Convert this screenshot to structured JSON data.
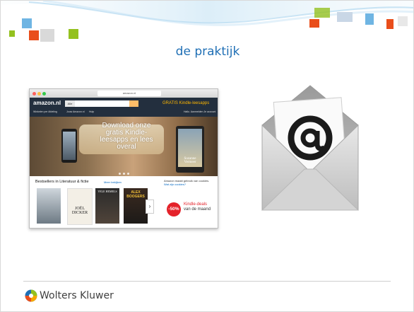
{
  "slide": {
    "title": "de praktijk",
    "accent": "#1f6fb5"
  },
  "footer": {
    "company": "Wolters Kluwer"
  },
  "amazon_screenshot": {
    "url": "amazon.nl",
    "logo": "amazon.nl",
    "search_scope": "Alle",
    "promo": "GRATIS Kindle-leesapps",
    "nav_left": "Winkelen per Afdeling",
    "nav_links": [
      "Jouw Amazon.nl",
      "Hulp"
    ],
    "nav_account": "Hallo. Aanmelden Je account",
    "banner_heading": "Download onze gratis Kindle-leesapps en lees overal",
    "banner_book": "Suzanne Vermeer",
    "bestsellers_title": "Bestsellers in Literatuur & fictie",
    "bestsellers_link": "Meer bekijken",
    "books": [
      {
        "title": ""
      },
      {
        "title": "JOËL DICKER"
      },
      {
        "title": "VELE HEMELS"
      },
      {
        "title": "ALEX BOOGERS"
      }
    ],
    "cookie_text": "Amazon maakt gebruik van cookies.",
    "cookie_link": "Wat zijn cookies?",
    "deal_badge": "-50%",
    "deal_line1": "Kindle-deals",
    "deal_line2": "van de maand"
  },
  "icons": {
    "email": "at-sign-envelope-icon",
    "logo": "wolters-kluwer-globe-icon"
  }
}
